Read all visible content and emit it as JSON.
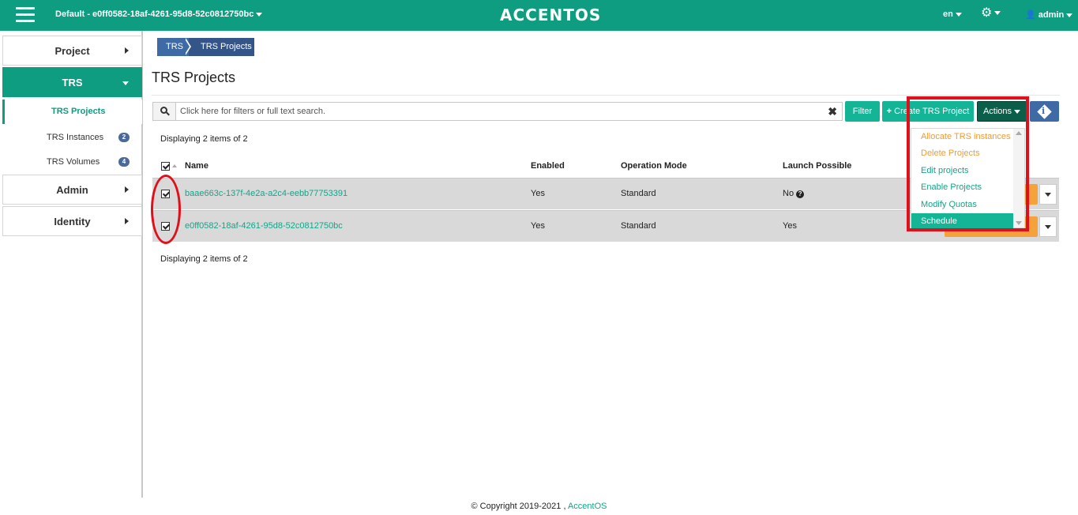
{
  "header": {
    "project_label": "Default - e0ff0582-18af-4261-95d8-52c0812750bc",
    "logo": "ACCENTOS",
    "lang": "en",
    "user": "admin"
  },
  "sidebar": {
    "project": "Project",
    "trs": "TRS",
    "trs_projects": "TRS Projects",
    "trs_instances": "TRS Instances",
    "trs_instances_count": "2",
    "trs_volumes": "TRS Volumes",
    "trs_volumes_count": "4",
    "admin": "Admin",
    "identity": "Identity"
  },
  "breadcrumb": {
    "root": "TRS",
    "current": "TRS Projects"
  },
  "page_title": "TRS Projects",
  "search": {
    "placeholder": "Click here for filters or full text search."
  },
  "buttons": {
    "filter": "Filter",
    "create": "Create TRS Project",
    "actions": "Actions"
  },
  "actions_menu": [
    "Allocate TRS instances",
    "Delete Projects",
    "Edit projects",
    "Enable Projects",
    "Modify Quotas",
    "Schedule"
  ],
  "table": {
    "count_top": "Displaying 2 items of 2",
    "count_bottom": "Displaying 2 items of 2",
    "headers": [
      "Name",
      "Enabled",
      "Operation Mode",
      "Launch Possible"
    ],
    "rows": [
      {
        "name": "baae663c-137f-4e2a-a2c4-eebb77753391",
        "enabled": "Yes",
        "mode": "Standard",
        "launch": "No"
      },
      {
        "name": "e0ff0582-18af-4261-95d8-52c0812750bc",
        "enabled": "Yes",
        "mode": "Standard",
        "launch": "Yes"
      }
    ]
  },
  "footer": {
    "text": "© Copyright 2019-2021 ,",
    "link": "AccentOS"
  },
  "colors": {
    "brand": "#0f9d81",
    "accent": "#14b596",
    "highlight": "#e0101a"
  }
}
